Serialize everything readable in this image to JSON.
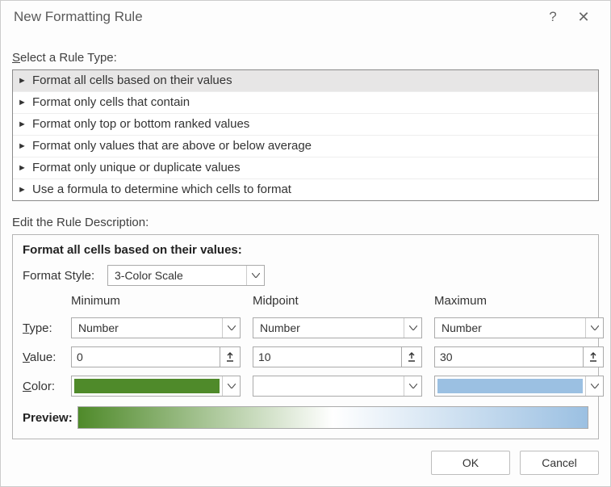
{
  "titlebar": {
    "title": "New Formatting Rule",
    "help": "?",
    "close": "✕"
  },
  "rule_type": {
    "label_prefix": "S",
    "label_rest": "elect a Rule Type:",
    "items": [
      "Format all cells based on their values",
      "Format only cells that contain",
      "Format only top or bottom ranked values",
      "Format only values that are above or below average",
      "Format only unique or duplicate values",
      "Use a formula to determine which cells to format"
    ],
    "selected_index": 0
  },
  "description": {
    "label": "Edit the Rule Description:",
    "title": "Format all cells based on their values:",
    "format_style_label": "Format Style:",
    "format_style_value": "3-Color Scale",
    "columns": {
      "min": "Minimum",
      "mid": "Midpoint",
      "max": "Maximum"
    },
    "rows": {
      "type_label_prefix": "T",
      "type_label_rest": "ype:",
      "value_label_prefix": "V",
      "value_label_rest": "alue:",
      "color_label_prefix": "C",
      "color_label_rest": "olor:"
    },
    "type": {
      "min": "Number",
      "mid": "Number",
      "max": "Number"
    },
    "value": {
      "min": "0",
      "mid": "10",
      "max": "30"
    },
    "color": {
      "min": "#4f8a2a",
      "mid": "#ffffff",
      "max": "#9bc0e2"
    },
    "preview_label": "Preview:"
  },
  "footer": {
    "ok": "OK",
    "cancel": "Cancel"
  }
}
